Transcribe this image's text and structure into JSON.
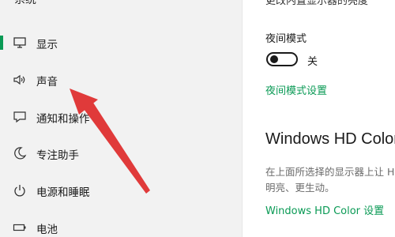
{
  "sidebar": {
    "title": "系统",
    "items": [
      {
        "label": "显示",
        "icon": "monitor-icon",
        "selected": true
      },
      {
        "label": "声音",
        "icon": "speaker-icon",
        "selected": false
      },
      {
        "label": "通知和操作",
        "icon": "notification-icon",
        "selected": false
      },
      {
        "label": "专注助手",
        "icon": "moon-icon",
        "selected": false
      },
      {
        "label": "电源和睡眠",
        "icon": "power-icon",
        "selected": false
      },
      {
        "label": "电池",
        "icon": "battery-icon",
        "selected": false
      }
    ]
  },
  "main": {
    "top_text": "更改内置显示器的亮度",
    "night_light": {
      "label": "夜间模式",
      "toggle_state": "关",
      "settings_link": "夜间模式设置"
    },
    "hd_color": {
      "heading": "Windows HD Color",
      "description_line1": "在上面所选择的显示器上让 HDR 和 WCG 视频、游戏和应用中的画面更",
      "description_line2": "明亮、更生动。",
      "settings_link": "Windows HD Color 设置"
    }
  },
  "colors": {
    "accent": "#0a9a55",
    "annotation_arrow": "#e03a3a"
  }
}
